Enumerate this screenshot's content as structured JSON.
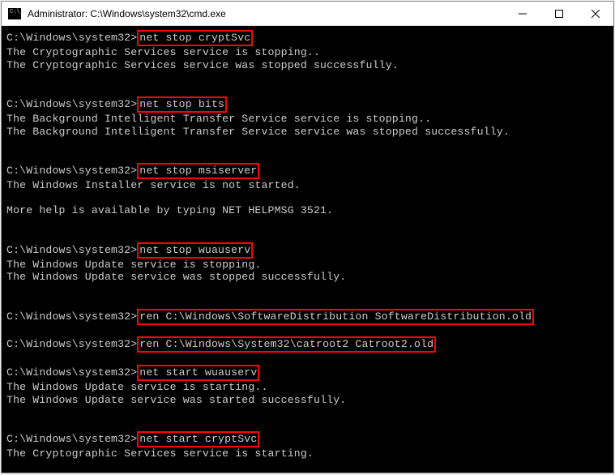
{
  "window": {
    "title": "Administrator: C:\\Windows\\system32\\cmd.exe"
  },
  "prompt": "C:\\Windows\\system32>",
  "lines": [
    {
      "type": "cmd",
      "cmd": "net stop cryptSvc"
    },
    {
      "type": "out",
      "text": "The Cryptographic Services service is stopping.."
    },
    {
      "type": "out",
      "text": "The Cryptographic Services service was stopped successfully."
    },
    {
      "type": "blank"
    },
    {
      "type": "blank"
    },
    {
      "type": "cmd",
      "cmd": "net stop bits"
    },
    {
      "type": "out",
      "text": "The Background Intelligent Transfer Service service is stopping.."
    },
    {
      "type": "out",
      "text": "The Background Intelligent Transfer Service service was stopped successfully."
    },
    {
      "type": "blank"
    },
    {
      "type": "blank"
    },
    {
      "type": "cmd",
      "cmd": "net stop msiserver"
    },
    {
      "type": "out",
      "text": "The Windows Installer service is not started."
    },
    {
      "type": "blank"
    },
    {
      "type": "out",
      "text": "More help is available by typing NET HELPMSG 3521."
    },
    {
      "type": "blank"
    },
    {
      "type": "blank"
    },
    {
      "type": "cmd",
      "cmd": "net stop wuauserv"
    },
    {
      "type": "out",
      "text": "The Windows Update service is stopping."
    },
    {
      "type": "out",
      "text": "The Windows Update service was stopped successfully."
    },
    {
      "type": "blank"
    },
    {
      "type": "blank"
    },
    {
      "type": "cmd",
      "cmd": "ren C:\\Windows\\SoftwareDistribution SoftwareDistribution.old"
    },
    {
      "type": "blank"
    },
    {
      "type": "cmd",
      "cmd": "ren C:\\Windows\\System32\\catroot2 Catroot2.old"
    },
    {
      "type": "blank"
    },
    {
      "type": "cmd",
      "cmd": "net start wuauserv"
    },
    {
      "type": "out",
      "text": "The Windows Update service is starting.."
    },
    {
      "type": "out",
      "text": "The Windows Update service was started successfully."
    },
    {
      "type": "blank"
    },
    {
      "type": "blank"
    },
    {
      "type": "cmd",
      "cmd": "net start cryptSvc"
    },
    {
      "type": "out",
      "text": "The Cryptographic Services service is starting."
    }
  ]
}
